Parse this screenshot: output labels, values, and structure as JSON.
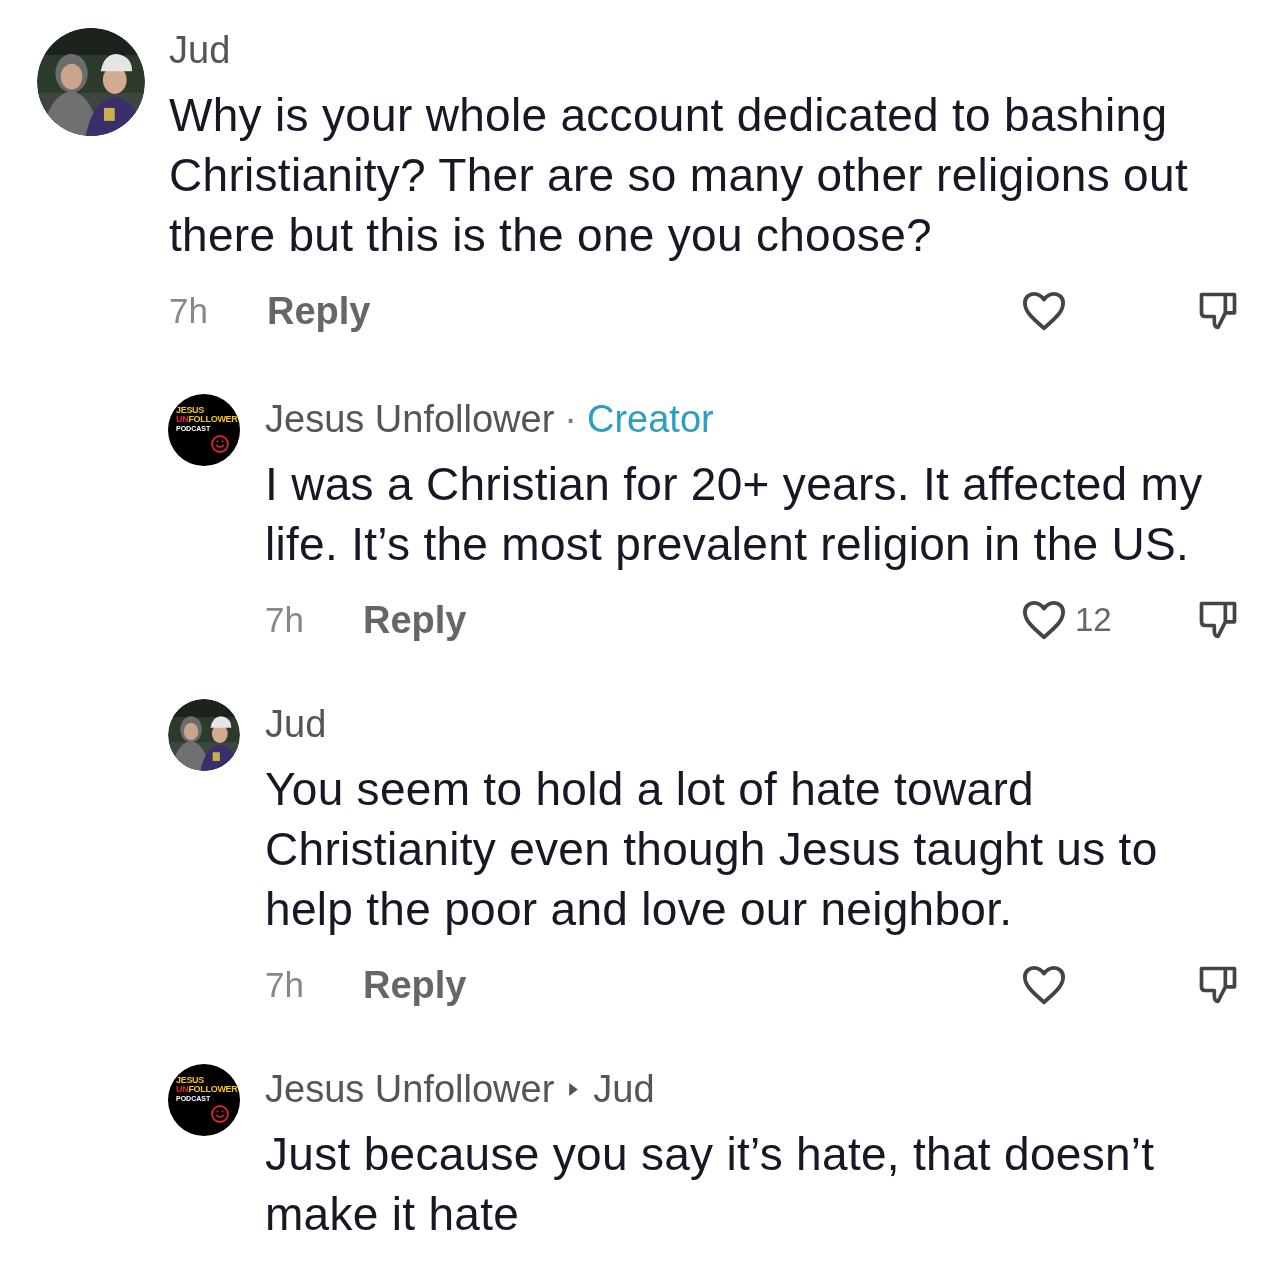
{
  "comments": [
    {
      "kind": "comment",
      "author": "Jud",
      "text": "Why is your whole account dedicated to bashing Christianity? Ther are so many other religions out there but this is the one you choose?",
      "time": "7h",
      "reply_label": "Reply"
    },
    {
      "kind": "reply",
      "avatar": {
        "kind": "logo",
        "line1": "JESUS",
        "line2_accent": "UN",
        "line2": "FOLLOWER",
        "line3": "PODCAST"
      },
      "author": "Jesus Unfollower",
      "separator": "·",
      "badge": "Creator",
      "text": "I was a Christian for 20+ years. It affected my life. It’s the most prevalent religion in the US.",
      "time": "7h",
      "reply_label": "Reply",
      "likes": "12"
    },
    {
      "kind": "reply",
      "author": "Jud",
      "text": "You seem to hold a lot of hate toward Christianity even though Jesus taught us to help the poor and love our neighbor.",
      "time": "7h",
      "reply_label": "Reply"
    },
    {
      "kind": "reply",
      "avatar": {
        "kind": "logo",
        "line1": "JESUS",
        "line2_accent": "UN",
        "line2": "FOLLOWER",
        "line3": "PODCAST"
      },
      "author": "Jesus Unfollower",
      "reply_to": "Jud",
      "text": "Just because you say it’s hate, that doesn’t make it hate"
    }
  ]
}
